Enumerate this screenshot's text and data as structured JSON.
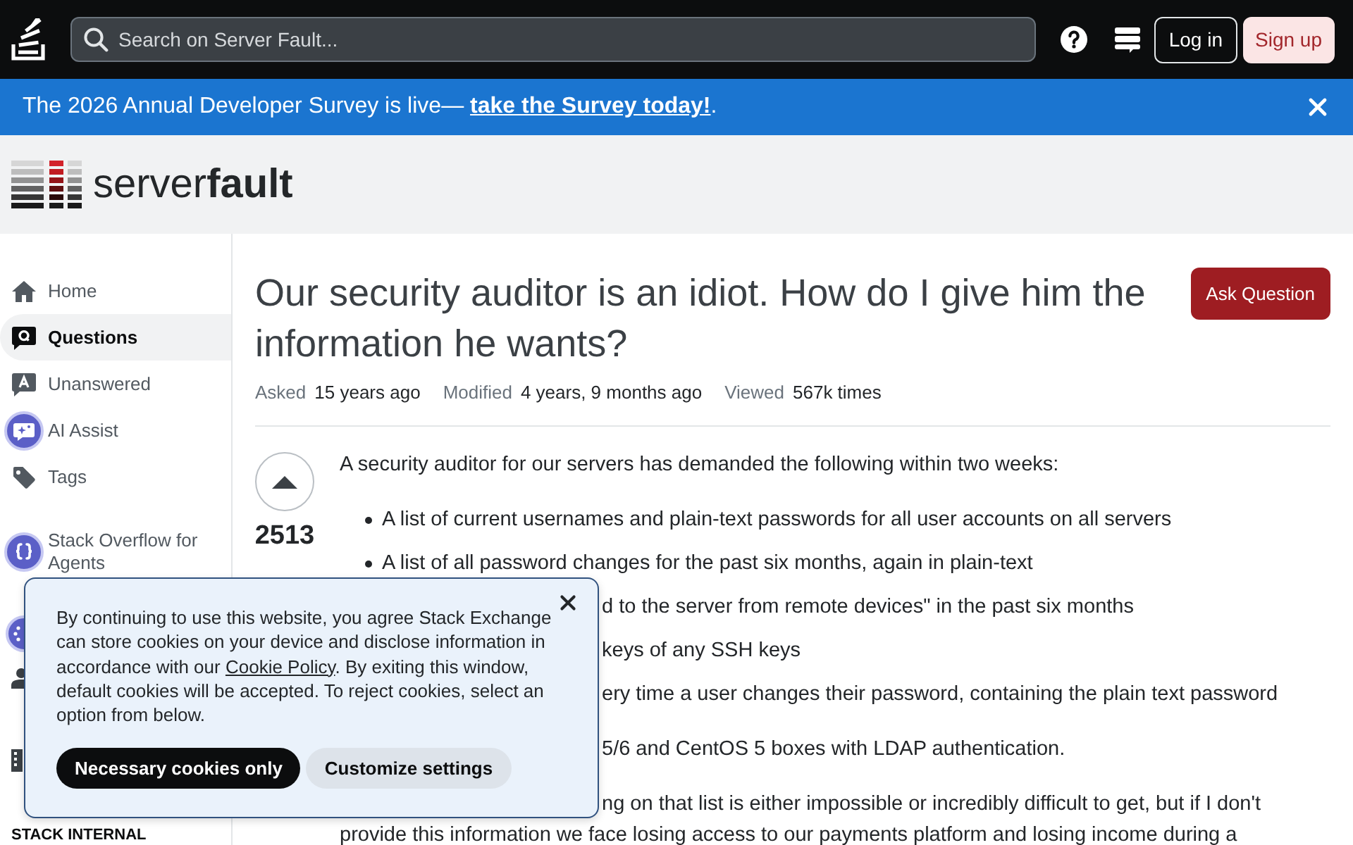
{
  "top_bar": {
    "search": {
      "placeholder": "Search on Server Fault..."
    },
    "log_in": "Log in",
    "sign_up": "Sign up"
  },
  "banner": {
    "text": "The 2026 Annual Developer Survey is live—",
    "link": "take the Survey today!",
    "after": "."
  },
  "site_header": {
    "logo_text": "server**fault**"
  },
  "sidebar": {
    "items": [
      {
        "label": "Home",
        "selected": false
      },
      {
        "label": "Questions",
        "selected": true
      },
      {
        "label": "Unanswered",
        "selected": false
      },
      {
        "label": "AI Assist",
        "selected": false
      },
      {
        "label": "Tags",
        "selected": false
      }
    ],
    "agents_link": "Stack Overflow for Agents",
    "section_heading": "STACK INTERNAL"
  },
  "question": {
    "title": "Our security auditor is an idiot. How do I give him the information he wants?",
    "ask_button": "Ask Question",
    "meta": [
      {
        "label": "Asked",
        "value": "15 years ago"
      },
      {
        "label": "Modified",
        "value": "4 years, 9 months ago"
      },
      {
        "label": "Viewed",
        "value": "567k times"
      }
    ],
    "score": "2513",
    "body": [
      {
        "kind": "paragraph",
        "text": "A security auditor for our servers has demanded the following within two weeks:"
      },
      {
        "kind": "bullet",
        "text": "A list of current usernames and plain-text passwords for all user accounts on all servers"
      },
      {
        "kind": "bullet",
        "text": "A list of all password changes for the past six months, again in plain-text"
      },
      {
        "kind": "covered_bullet",
        "text": "d to the server from remote devices\" in the past six months"
      },
      {
        "kind": "covered_bullet",
        "text": "keys of any SSH keys"
      },
      {
        "kind": "covered_bullet",
        "text": "ery time a user changes their password, containing the plain text password"
      },
      {
        "kind": "covered_paragraph",
        "text": "5/6 and CentOS 5 boxes with LDAP authentication."
      },
      {
        "kind": "covered_paragraph",
        "text": "ng on that list is either impossible or incredibly difficult to get, but if I don't"
      },
      {
        "kind": "line",
        "text": "provide this information we face losing access to our payments platform and losing income during a"
      }
    ]
  },
  "cookie_notice": {
    "text_before": "By continuing to use this website, you agree Stack Exchange can store cookies on your device and disclose information in accordance with our",
    "link": "Cookie Policy",
    "text_after": ". By exiting this window, default cookies will be accepted. To reject cookies, select an option from below.",
    "buttons": [
      {
        "label": "Necessary cookies only",
        "kind": "primary"
      },
      {
        "label": "Customize settings",
        "kind": "secondary"
      }
    ]
  }
}
